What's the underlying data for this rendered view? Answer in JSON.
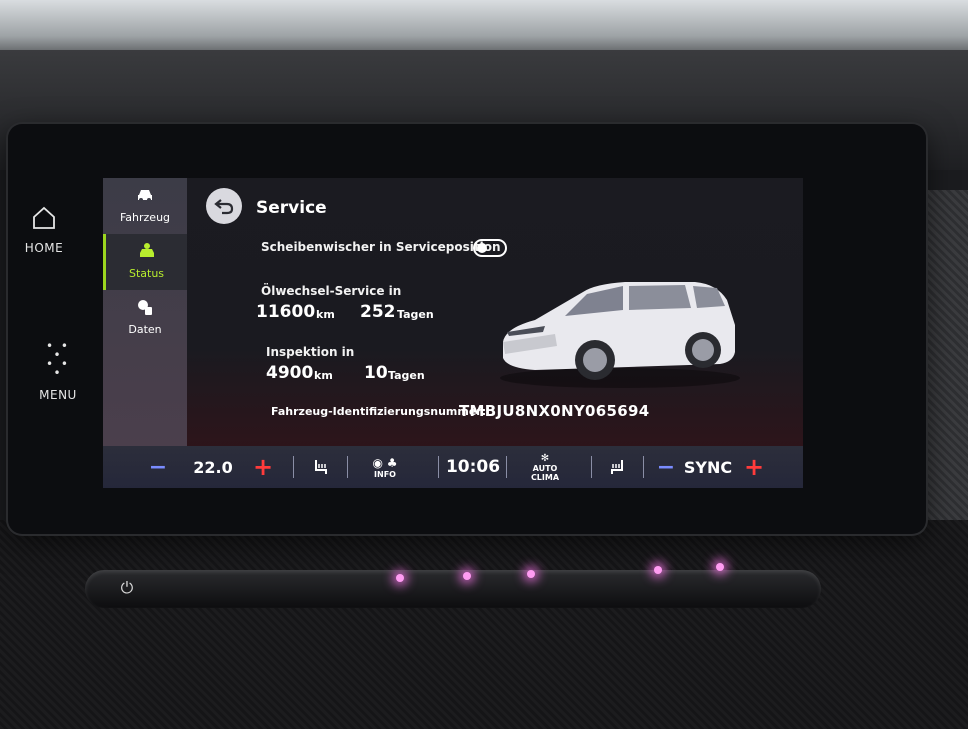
{
  "side_nav": {
    "home_label": "HOME",
    "menu_label": "MENU"
  },
  "sub_nav": [
    {
      "label": "Fahrzeug",
      "icon": "car-icon"
    },
    {
      "label": "Status",
      "icon": "car-status-icon",
      "active": true
    },
    {
      "label": "Daten",
      "icon": "data-icon"
    }
  ],
  "header": {
    "title": "Service"
  },
  "wiper": {
    "label": "Scheibenwischer in Serviceposition",
    "toggle_on": false
  },
  "oil_service": {
    "label": "Ölwechsel-Service in",
    "km_value": "11600",
    "km_unit": "km",
    "days_value": "252",
    "days_unit": "Tagen"
  },
  "inspection": {
    "label": "Inspektion in",
    "km_value": "4900",
    "km_unit": "km",
    "days_value": "10",
    "days_unit": "Tagen"
  },
  "vin": {
    "label": "Fahrzeug-Identifizierungsnummer:",
    "value": "TMBJU8NX0NY065694"
  },
  "climate_bar": {
    "left_minus": "−",
    "left_temp": "22.0",
    "left_plus": "+",
    "info_label": "INFO",
    "time": "10:06",
    "auto_label": "AUTO",
    "clima_label": "CLIMA",
    "right_minus": "−",
    "sync_label": "SYNC",
    "right_plus": "+"
  },
  "colors": {
    "active_accent": "#9cd61f",
    "minus_color": "#7a8cff",
    "plus_color": "#ff3b3b",
    "glow": "#d2192a"
  }
}
